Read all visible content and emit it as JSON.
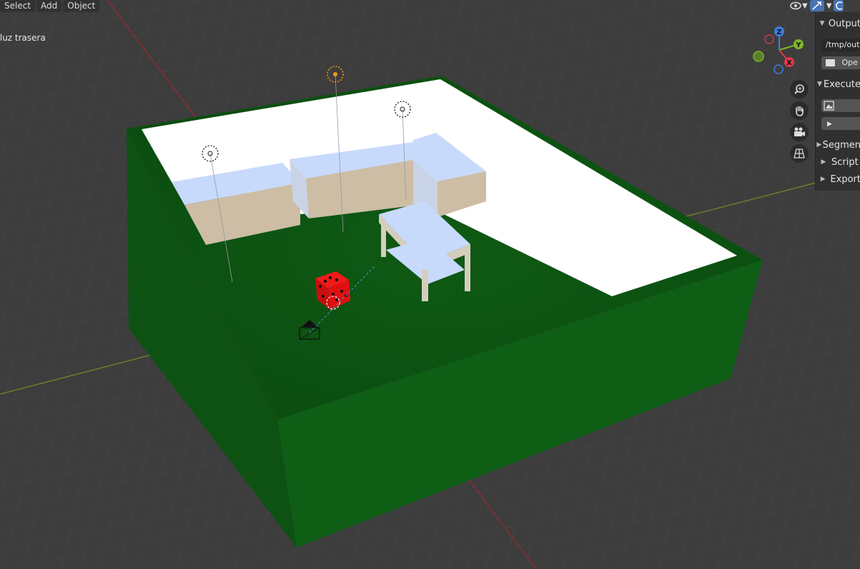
{
  "menu": [
    "Select",
    "Add",
    "Object"
  ],
  "viewport": {
    "label": "| luz trasera"
  },
  "gizmo": {
    "z": "Z",
    "y": "Y",
    "x": "X"
  },
  "panel": {
    "output": {
      "title": "Output",
      "path": "/tmp/outp",
      "open_label": "Ope"
    },
    "execute": {
      "title": "Execute"
    },
    "sections": [
      "Segmen",
      "Script",
      "Export"
    ]
  },
  "nav_icons": [
    "zoom-icon",
    "hand-pan-icon",
    "camera-view-icon",
    "grid-perspective-icon"
  ],
  "colors": {
    "background": "#3d3d3d",
    "floor": "#0c5212",
    "walls": "#0e5c15",
    "die": "#e01010",
    "accent": "#4772b3"
  }
}
